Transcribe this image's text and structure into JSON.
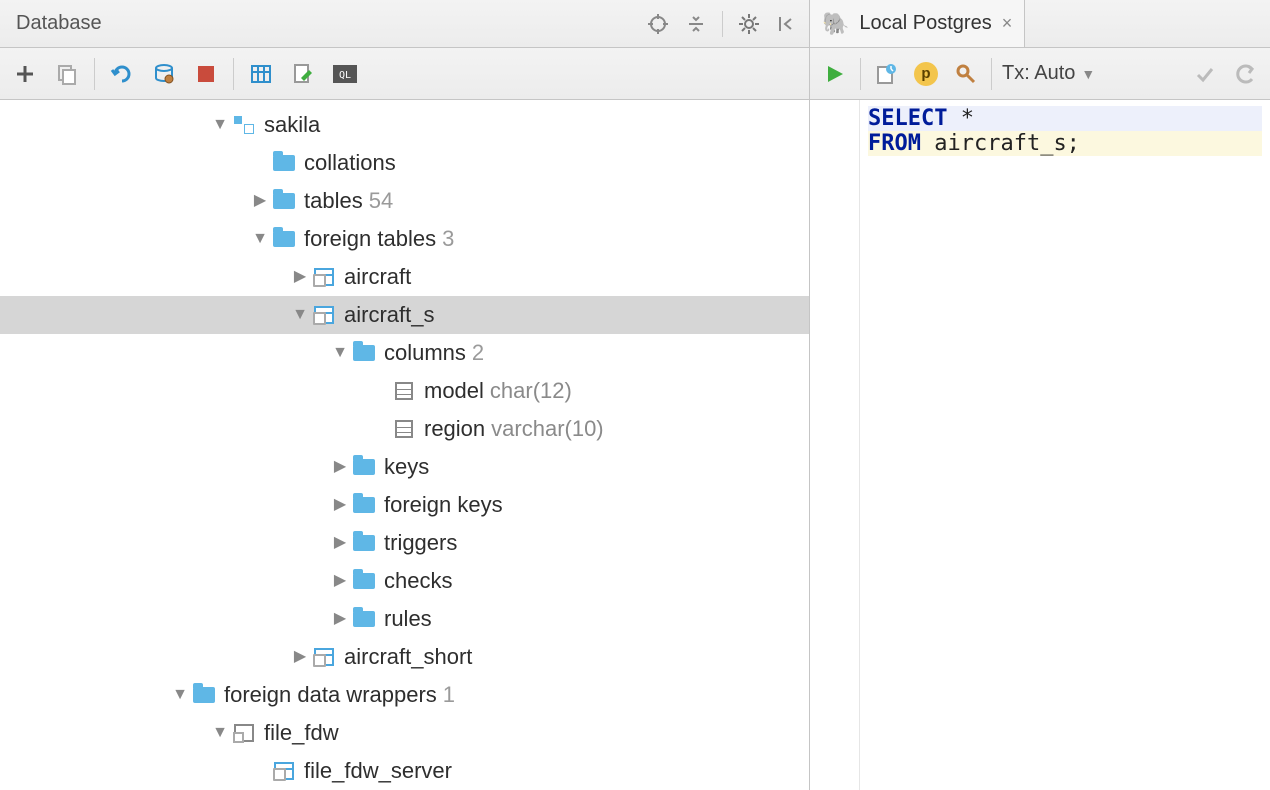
{
  "database_panel": {
    "title": "Database"
  },
  "tree": {
    "sakila": {
      "label": "sakila"
    },
    "collations": {
      "label": "collations"
    },
    "tables": {
      "label": "tables",
      "count": "54"
    },
    "foreign_tables": {
      "label": "foreign tables",
      "count": "3"
    },
    "aircraft": {
      "label": "aircraft"
    },
    "aircraft_s": {
      "label": "aircraft_s"
    },
    "columns": {
      "label": "columns",
      "count": "2"
    },
    "model": {
      "label": "model",
      "type": "char(12)"
    },
    "region": {
      "label": "region",
      "type": "varchar(10)"
    },
    "keys": {
      "label": "keys"
    },
    "foreign_keys": {
      "label": "foreign keys"
    },
    "triggers": {
      "label": "triggers"
    },
    "checks": {
      "label": "checks"
    },
    "rules": {
      "label": "rules"
    },
    "aircraft_short": {
      "label": "aircraft_short"
    },
    "fdw": {
      "label": "foreign data wrappers",
      "count": "1"
    },
    "file_fdw": {
      "label": "file_fdw"
    },
    "file_fdw_server": {
      "label": "file_fdw_server"
    }
  },
  "tab": {
    "label": "Local Postgres"
  },
  "editor_toolbar": {
    "tx": "Tx: Auto"
  },
  "sql": {
    "select": "SELECT",
    "star": "*",
    "from": "FROM",
    "table": "aircraft_s;"
  }
}
